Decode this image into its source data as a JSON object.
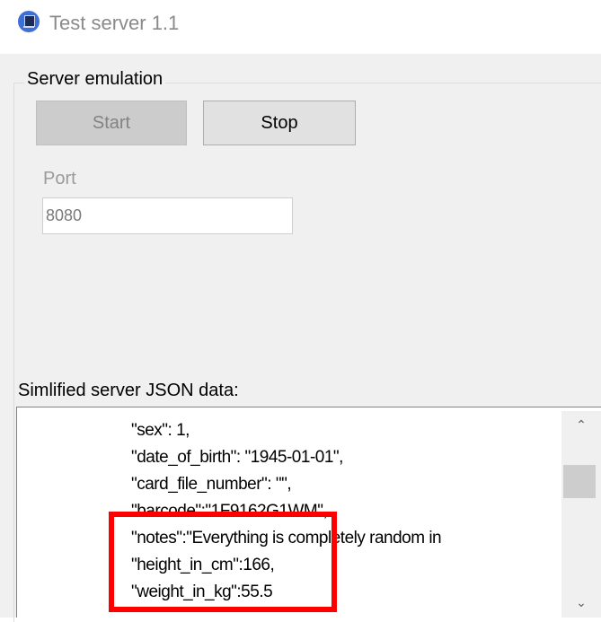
{
  "window": {
    "title": "Test server 1.1",
    "icon": "server-app-icon"
  },
  "server_emulation": {
    "group_label": "Server emulation",
    "start_label": "Start",
    "start_enabled": false,
    "stop_label": "Stop",
    "port_label": "Port",
    "port_value": "8080"
  },
  "json_data": {
    "label": "Simlified server JSON data:",
    "lines": [
      "\"sex\": 1,",
      "\"date_of_birth\": \"1945-01-01\",",
      "\"card_file_number\": \"\",",
      "\"barcode\":\"1F9162G1WM\",",
      "\"notes\":\"Everything is completely random in",
      "\"height_in_cm\":166,",
      "\"weight_in_kg\":55.5"
    ]
  },
  "annotation": {
    "highlight_color": "#ff0000"
  }
}
